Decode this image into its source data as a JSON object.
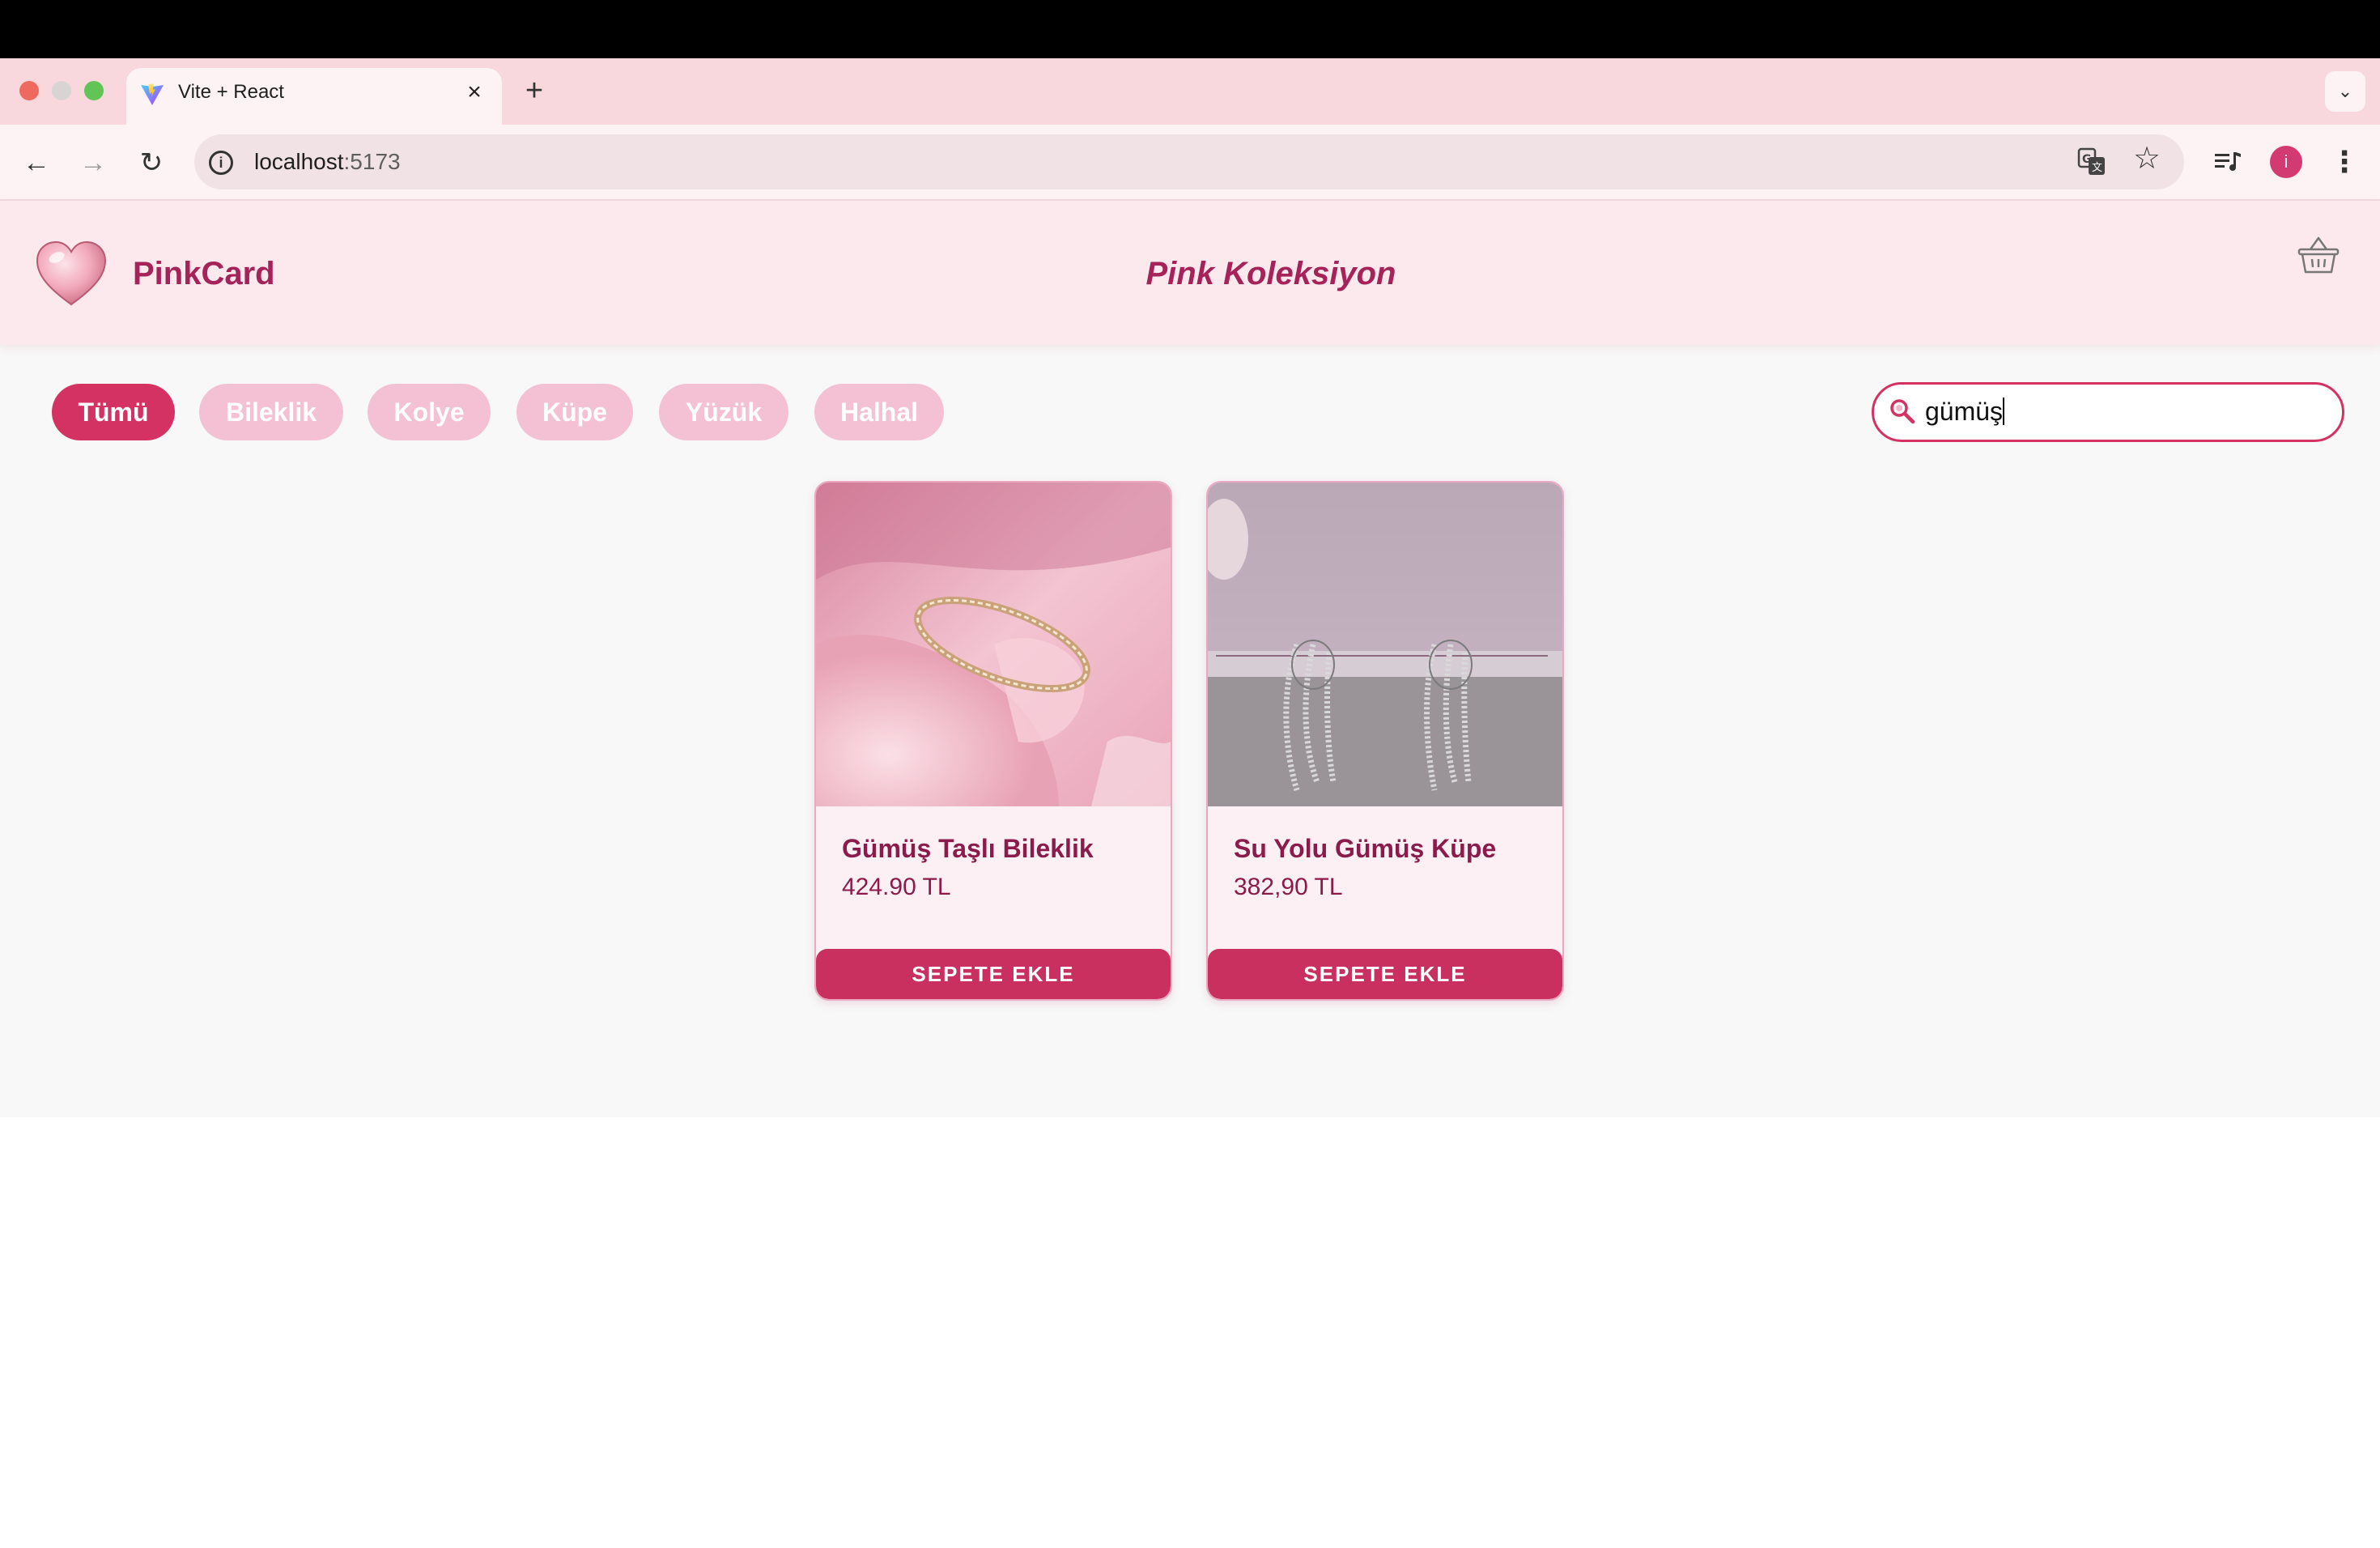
{
  "browser": {
    "tab_title": "Vite + React",
    "url_host": "localhost",
    "url_port": ":5173",
    "profile_initial": "i"
  },
  "site": {
    "brand": "PinkCard",
    "collection_title": "Pink Koleksiyon"
  },
  "filters": {
    "chips": [
      "Tümü",
      "Bileklik",
      "Kolye",
      "Küpe",
      "Yüzük",
      "Halhal"
    ],
    "active": "Tümü"
  },
  "search": {
    "value": "gümüş"
  },
  "products": [
    {
      "name": "Gümüş Taşlı Bileklik",
      "price": "424.90 TL",
      "button": "SEPETE EKLE"
    },
    {
      "name": "Su Yolu Gümüş Küpe",
      "price": "382,90 TL",
      "button": "SEPETE EKLE"
    }
  ],
  "colors": {
    "accent": "#d43262",
    "brand_text": "#a6235a",
    "chip_inactive": "#f3c1d3",
    "header_bg": "#fce9ee"
  }
}
